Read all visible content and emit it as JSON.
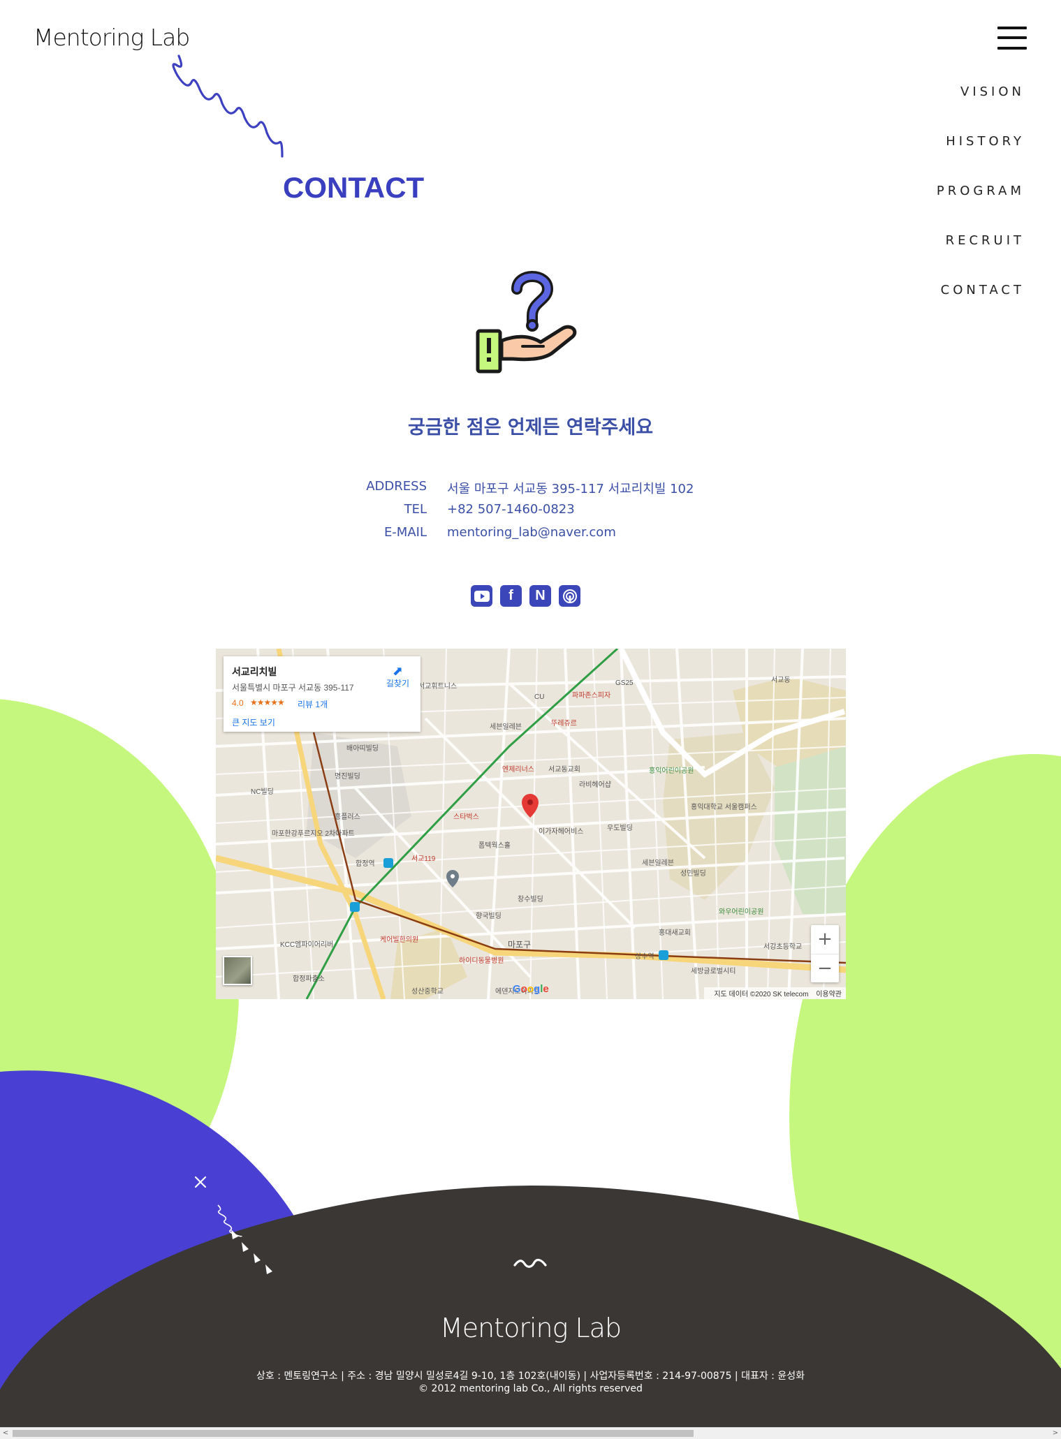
{
  "brand": {
    "logo_text": "Mentoring Lab"
  },
  "page_title": "CONTACT",
  "nav": {
    "items": [
      {
        "label": "VISION"
      },
      {
        "label": "HISTORY"
      },
      {
        "label": "PROGRAM"
      },
      {
        "label": "RECRUIT"
      },
      {
        "label": "CONTACT"
      }
    ]
  },
  "contact": {
    "headline": "궁금한 점은 언제든 연락주세요",
    "rows": [
      {
        "label": "ADDRESS",
        "value": "서울 마포구 서교동 395-117 서교리치빌 102"
      },
      {
        "label": "TEL",
        "value": "+82 507-1460-0823"
      },
      {
        "label": "E-MAIL",
        "value": "mentoring_lab@naver.com"
      }
    ],
    "socials": [
      {
        "icon": "youtube-icon"
      },
      {
        "icon": "facebook-icon",
        "glyph": "f"
      },
      {
        "icon": "naver-icon",
        "glyph": "N"
      },
      {
        "icon": "podcast-icon"
      }
    ]
  },
  "map": {
    "place_name": "서교리치빌",
    "place_address": "서울특별시 마포구 서교동 395-117",
    "rating": "4.0",
    "stars": "★★★★★",
    "reviews": "리뷰 1개",
    "larger_map": "큰 지도 보기",
    "directions": "길찾기",
    "zoom_in": "+",
    "zoom_out": "−",
    "google": "Google",
    "attribution": "지도 데이터 ©2020 SK telecom",
    "terms": "이용약관",
    "labels": [
      "서교동",
      "서교휘트니스",
      "세븐일레븐",
      "파파존스피자",
      "뚜레쥬르",
      "엔제리너스",
      "서교동교회",
      "라비헤어샵",
      "스타벅스",
      "합정역",
      "서교119",
      "폼텍웍스홀",
      "이가자헤어비스",
      "우도빌딩",
      "세븐일레븐",
      "성민빌딩",
      "홍익어린이공원",
      "홍익대학교 서울캠퍼스",
      "와우어린이공원",
      "홍대새교회",
      "서강초등학교",
      "상수역",
      "마포구",
      "합정파출소",
      "케어빌한의원",
      "하이디동물병원",
      "에덴지오아파트",
      "성산중학교",
      "KCC엠파이어리버",
      "마포한강푸르지오 2차아파트",
      "흥플러스",
      "NC빌딩",
      "배아띠빌딩",
      "명진빌딩",
      "창수빌딩",
      "향국빌딩",
      "CU",
      "GS25",
      "세방글로벌시티"
    ]
  },
  "footer": {
    "logo_text": "Mentoring Lab",
    "info_line": "상호 : 멘토링연구소 | 주소 : 경남 밀양시 밀성로4길 9-10, 1층 102호(내이동) | 사업자등록번호 : 214-97-00875 | 대표자 : 윤성화",
    "copyright": "© 2012 mentoring lab Co., All rights reserved"
  },
  "colors": {
    "accent_blue": "#3a3fbf",
    "text_blue": "#3b4fa6",
    "lime": "#c5f67e",
    "violet": "#4a3fd3",
    "dark": "#3a3735"
  }
}
